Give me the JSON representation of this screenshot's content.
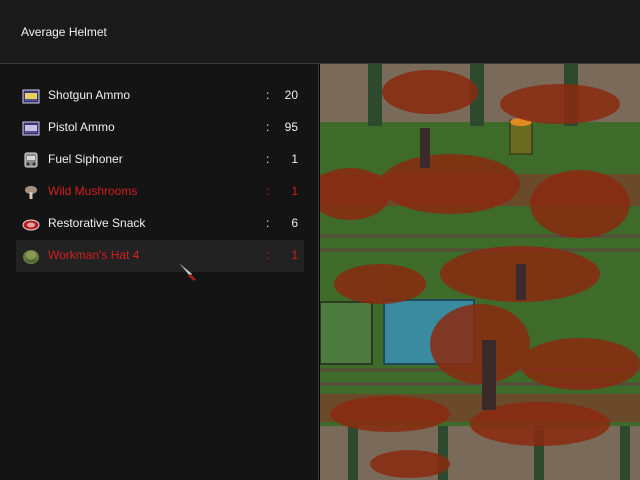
{
  "header": {
    "title": "Average Helmet"
  },
  "inventory": {
    "items": [
      {
        "name": "Shotgun Ammo",
        "quantity": "20",
        "icon": "ammo-box-icon",
        "color": "#f0f0f0"
      },
      {
        "name": "Pistol Ammo",
        "quantity": "95",
        "icon": "ammo-box-icon",
        "color": "#f0f0f0"
      },
      {
        "name": "Fuel Siphoner",
        "quantity": "1",
        "icon": "siphon-icon",
        "color": "#f0f0f0"
      },
      {
        "name": "Wild Mushrooms",
        "quantity": "1",
        "icon": "mushroom-icon",
        "color": "#d21e1e"
      },
      {
        "name": "Restorative Snack",
        "quantity": "6",
        "icon": "meat-icon",
        "color": "#f0f0f0"
      },
      {
        "name": "Workman's Hat 4",
        "quantity": "1",
        "icon": "hat-icon",
        "color": "#d21e1e",
        "selected": true
      }
    ],
    "separator": ":"
  },
  "colors": {
    "panel_bg": "#141414",
    "header_bg": "#1a1a1a",
    "selected_row_bg": "#222222",
    "normal_text": "#f0f0f0",
    "highlight_text": "#d21e1e",
    "blood": "#8a2a10",
    "grass": "#3f6b2a"
  }
}
